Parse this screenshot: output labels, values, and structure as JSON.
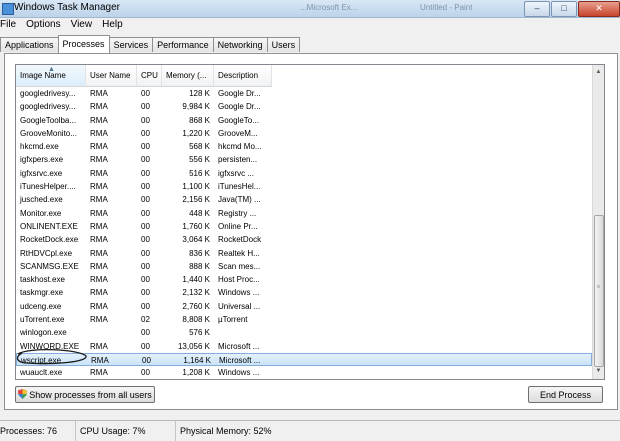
{
  "window": {
    "title": "Windows Task Manager",
    "ghost_left": "...Microsoft Ex...",
    "ghost_right": "Untitled - Paint",
    "controls": {
      "minimize": "–",
      "maximize": "□",
      "close": "✕"
    }
  },
  "menu": [
    "File",
    "Options",
    "View",
    "Help"
  ],
  "tabs": [
    {
      "label": "Applications",
      "active": false
    },
    {
      "label": "Processes",
      "active": true
    },
    {
      "label": "Services",
      "active": false
    },
    {
      "label": "Performance",
      "active": false
    },
    {
      "label": "Networking",
      "active": false
    },
    {
      "label": "Users",
      "active": false
    }
  ],
  "columns": [
    "Image Name",
    "User Name",
    "CPU",
    "Memory (...",
    "Description"
  ],
  "processes": [
    [
      "googledrivesy...",
      "RMA",
      "00",
      "128 K",
      "Google Dr..."
    ],
    [
      "googledrivesy...",
      "RMA",
      "00",
      "9,984 K",
      "Google Dr..."
    ],
    [
      "GoogleToolba...",
      "RMA",
      "00",
      "868 K",
      "GoogleTo..."
    ],
    [
      "GrooveMonito...",
      "RMA",
      "00",
      "1,220 K",
      "GrooveM..."
    ],
    [
      "hkcmd.exe",
      "RMA",
      "00",
      "568 K",
      "hkcmd Mo..."
    ],
    [
      "igfxpers.exe",
      "RMA",
      "00",
      "556 K",
      "persisten..."
    ],
    [
      "igfxsrvc.exe",
      "RMA",
      "00",
      "516 K",
      "igfxsrvc ..."
    ],
    [
      "iTunesHelper....",
      "RMA",
      "00",
      "1,100 K",
      "iTunesHel..."
    ],
    [
      "jusched.exe",
      "RMA",
      "00",
      "2,156 K",
      "Java(TM) ..."
    ],
    [
      "Monitor.exe",
      "RMA",
      "00",
      "448 K",
      "Registry ..."
    ],
    [
      "ONLINENT.EXE",
      "RMA",
      "00",
      "1,760 K",
      "Online Pr..."
    ],
    [
      "RocketDock.exe",
      "RMA",
      "00",
      "3,064 K",
      "RocketDock"
    ],
    [
      "RtHDVCpl.exe",
      "RMA",
      "00",
      "836 K",
      "Realtek H..."
    ],
    [
      "SCANMSG.EXE",
      "RMA",
      "00",
      "888 K",
      "Scan mes..."
    ],
    [
      "taskhost.exe",
      "RMA",
      "00",
      "1,440 K",
      "Host Proc..."
    ],
    [
      "taskmgr.exe",
      "RMA",
      "00",
      "2,132 K",
      "Windows ..."
    ],
    [
      "udceng.exe",
      "RMA",
      "00",
      "2,760 K",
      "Universal ..."
    ],
    [
      "uTorrent.exe",
      "RMA",
      "02",
      "8,808 K",
      "µTorrent"
    ],
    [
      "winlogon.exe",
      "",
      "00",
      "576 K",
      ""
    ],
    [
      "WINWORD.EXE",
      "RMA",
      "00",
      "13,056 K",
      "Microsoft ..."
    ],
    [
      "wscript.exe",
      "RMA",
      "00",
      "1,164 K",
      "Microsoft ..."
    ],
    [
      "wuauclt.exe",
      "RMA",
      "00",
      "1,208 K",
      "Windows ..."
    ]
  ],
  "selected_index": 20,
  "buttons": {
    "show_all": "Show processes from all users",
    "end_process": "End Process"
  },
  "status": {
    "processes": "Processes: 76",
    "cpu": "CPU Usage: 7%",
    "memory": "Physical Memory: 52%"
  },
  "colors": {
    "selection": "#c9e3f8",
    "annotation": "#1a1a1a"
  }
}
